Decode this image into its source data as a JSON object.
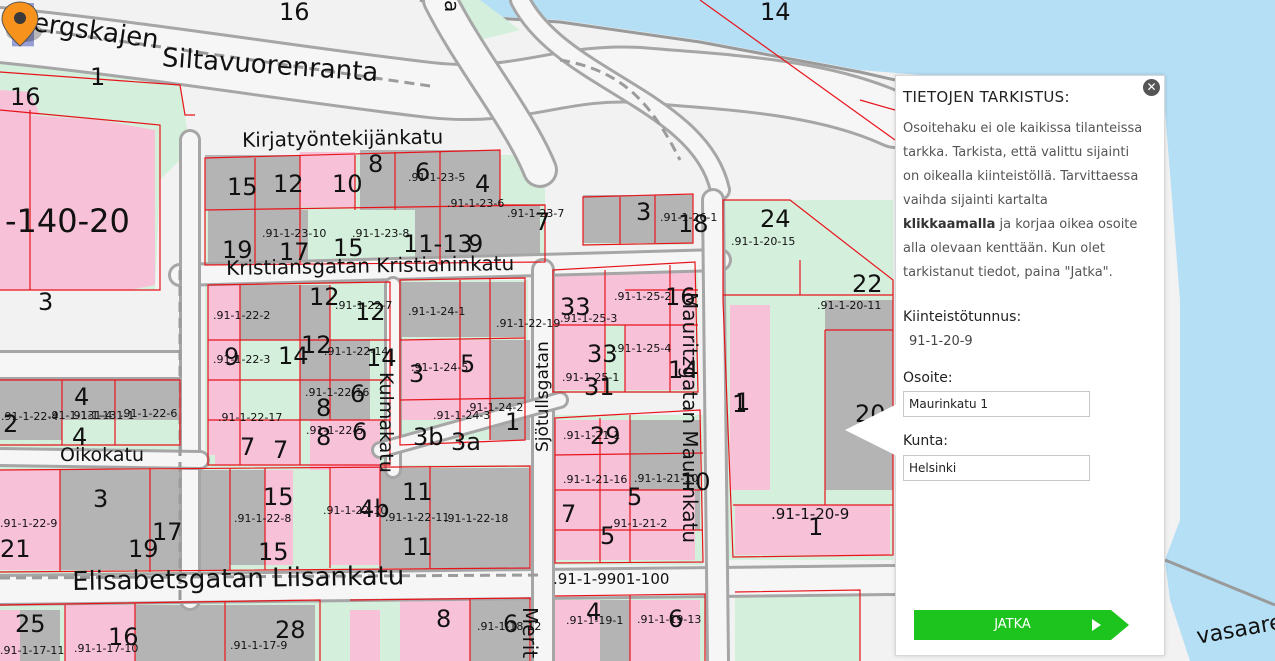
{
  "map": {
    "zoom_in_label": "+",
    "zoom_out_label": "−",
    "street_labels": [
      "Siltavuorenranta",
      "Kirjatyöntekijänkatu",
      "Kristiansgatan Kristianinkatu",
      "Mauritzgatan Maurinkatu",
      "Oikokatu",
      "Kulmakatu",
      "Sjötullsgatan",
      "Elisabetsgatan Liisankatu",
      "ergskajen",
      "Merit",
      "vasaaren",
      "a"
    ],
    "big_labels": [
      "-140-20",
      "1",
      "16",
      "3",
      "2",
      "4",
      "4",
      "21",
      "25"
    ],
    "parcel_labels": [
      ".91-1-23-5",
      ".91-1-23-6",
      ".91-1-23-7",
      ".91-1-23-8",
      ".91-1-23-10",
      ".91-1-22-2",
      ".91-1-22-3",
      ".91-1-22-7",
      ".91-1-22-14",
      ".91-1-22-16",
      ".91-1-22-5",
      ".91-1-22-17",
      ".91-1-22-4",
      ".91-1-22-6",
      ".91-1-22-8",
      ".91-1-22-9",
      ".91-1-22-10",
      ".91-1-22-11",
      ".91-1-22-18",
      ".91-1-22-19",
      ".91-1-24-1",
      ".91-1-24-2",
      ".91-1-24-3",
      ".91-1-24-5",
      ".91-1-25-1",
      ".91-1-25-2",
      ".91-1-25-3",
      ".91-1-25-4",
      ".91-1-21-1",
      ".91-1-21-2",
      ".91-1-21-10",
      ".91-1-21-16",
      ".91-1-20-9",
      ".91-1-20-11",
      ".91-1-20-15",
      ".91-1-131-4",
      ".91-1-131-1",
      ".91-1-26-1",
      ".91-1-9901-100",
      ".91-1-19-1",
      ".91-1-19-13",
      ".91-1-18-12",
      ".91-1-17-9",
      ".91-1-17-10",
      ".91-1-17-11"
    ],
    "number_labels": [
      "15",
      "12",
      "10",
      "8",
      "6",
      "4",
      "7",
      "19",
      "17",
      "15",
      "11-13",
      "9",
      "3",
      "18",
      "24",
      "22",
      "16",
      "14",
      "12",
      "12",
      "9",
      "14",
      "12",
      "14",
      "8",
      "6",
      "8",
      "6",
      "7",
      "7",
      "3",
      "33",
      "33",
      "31",
      "16",
      "14",
      "1",
      "29",
      "5",
      "10",
      "7",
      "5",
      "5",
      "3b",
      "3a",
      "1",
      "3",
      "15",
      "4b",
      "11",
      "11",
      "17",
      "19",
      "15",
      "1",
      "1",
      "8",
      "6",
      "4",
      "6",
      "28",
      "16",
      "20"
    ]
  },
  "panel": {
    "title": "TIETOJEN TARKISTUS:",
    "close_icon": "close-icon",
    "instructions_part1": "Osoitehaku ei ole kaikissa tilanteissa tarkka. Tarkista, että valittu sijainti on oikealla kiinteistöllä. Tarvittaessa vaihda sijainti kartalta ",
    "instructions_bold": "klikkaamalla",
    "instructions_part2": " ja korjaa oikea osoite alla olevaan kenttään. Kun olet tarkistanut tiedot, paina \"Jatka\".",
    "property_id_label": "Kiinteistötunnus:",
    "property_id_value": "91-1-20-9",
    "address_label": "Osoite:",
    "address_value": "Maurinkatu 1",
    "municipality_label": "Kunta:",
    "municipality_value": "Helsinki",
    "continue_label": "JATKA"
  },
  "colors": {
    "water": "#b5dff5",
    "park": "#d4f0dc",
    "building_pink": "#f7c1d8",
    "building_gray": "#b4b4b4",
    "road": "#f2f2f2",
    "parcel_line": "#e8141c",
    "button_green": "#1ec41e",
    "marker_orange": "#f7931d"
  }
}
